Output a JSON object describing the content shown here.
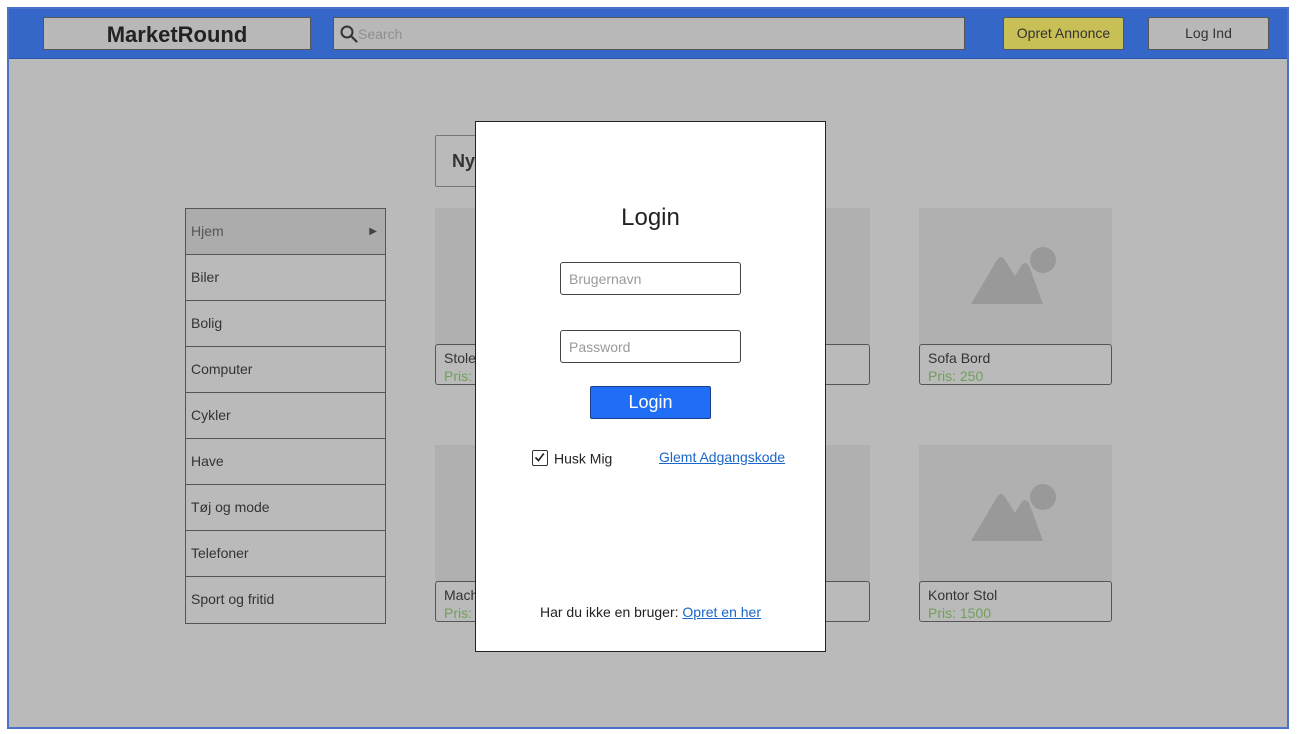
{
  "header": {
    "logo": "MarketRound",
    "search_placeholder": "Search",
    "create_label": "Opret Annonce",
    "login_label": "Log Ind"
  },
  "section": {
    "title_partial": "Ny"
  },
  "sidebar": {
    "items": [
      {
        "label": "Hjem",
        "active": true
      },
      {
        "label": "Biler"
      },
      {
        "label": "Bolig"
      },
      {
        "label": "Computer"
      },
      {
        "label": "Cykler"
      },
      {
        "label": "Have"
      },
      {
        "label": "Tøj og mode"
      },
      {
        "label": "Telefoner"
      },
      {
        "label": "Sport og fritid"
      }
    ]
  },
  "products": [
    {
      "title": "Stole",
      "price": "Pris:"
    },
    {
      "title": "Sofa Bord",
      "price": "Pris: 250"
    },
    {
      "title": "Mach",
      "price": "Pris:"
    },
    {
      "title": "Kontor Stol",
      "price": "Pris: 1500"
    }
  ],
  "modal": {
    "title": "Login",
    "username_placeholder": "Brugernavn",
    "password_placeholder": "Password",
    "login_button": "Login",
    "remember_label": "Husk Mig",
    "remember_checked": true,
    "forgot_link": "Glemt Adgangskode",
    "signup_text": "Har du ikke en bruger: ",
    "signup_link": "Opret en her"
  },
  "colors": {
    "header_bg": "#3467c7",
    "overlay_bg": "#bababa",
    "create_button": "#c8bf56",
    "login_button": "#1f6ef5",
    "price_text": "#6fa05b",
    "link": "#1b66c9"
  },
  "icons": {
    "search": "search-icon",
    "sidebar_arrow": "play-arrow-icon",
    "placeholder": "image-placeholder-icon",
    "checkbox": "checkmark-icon"
  }
}
